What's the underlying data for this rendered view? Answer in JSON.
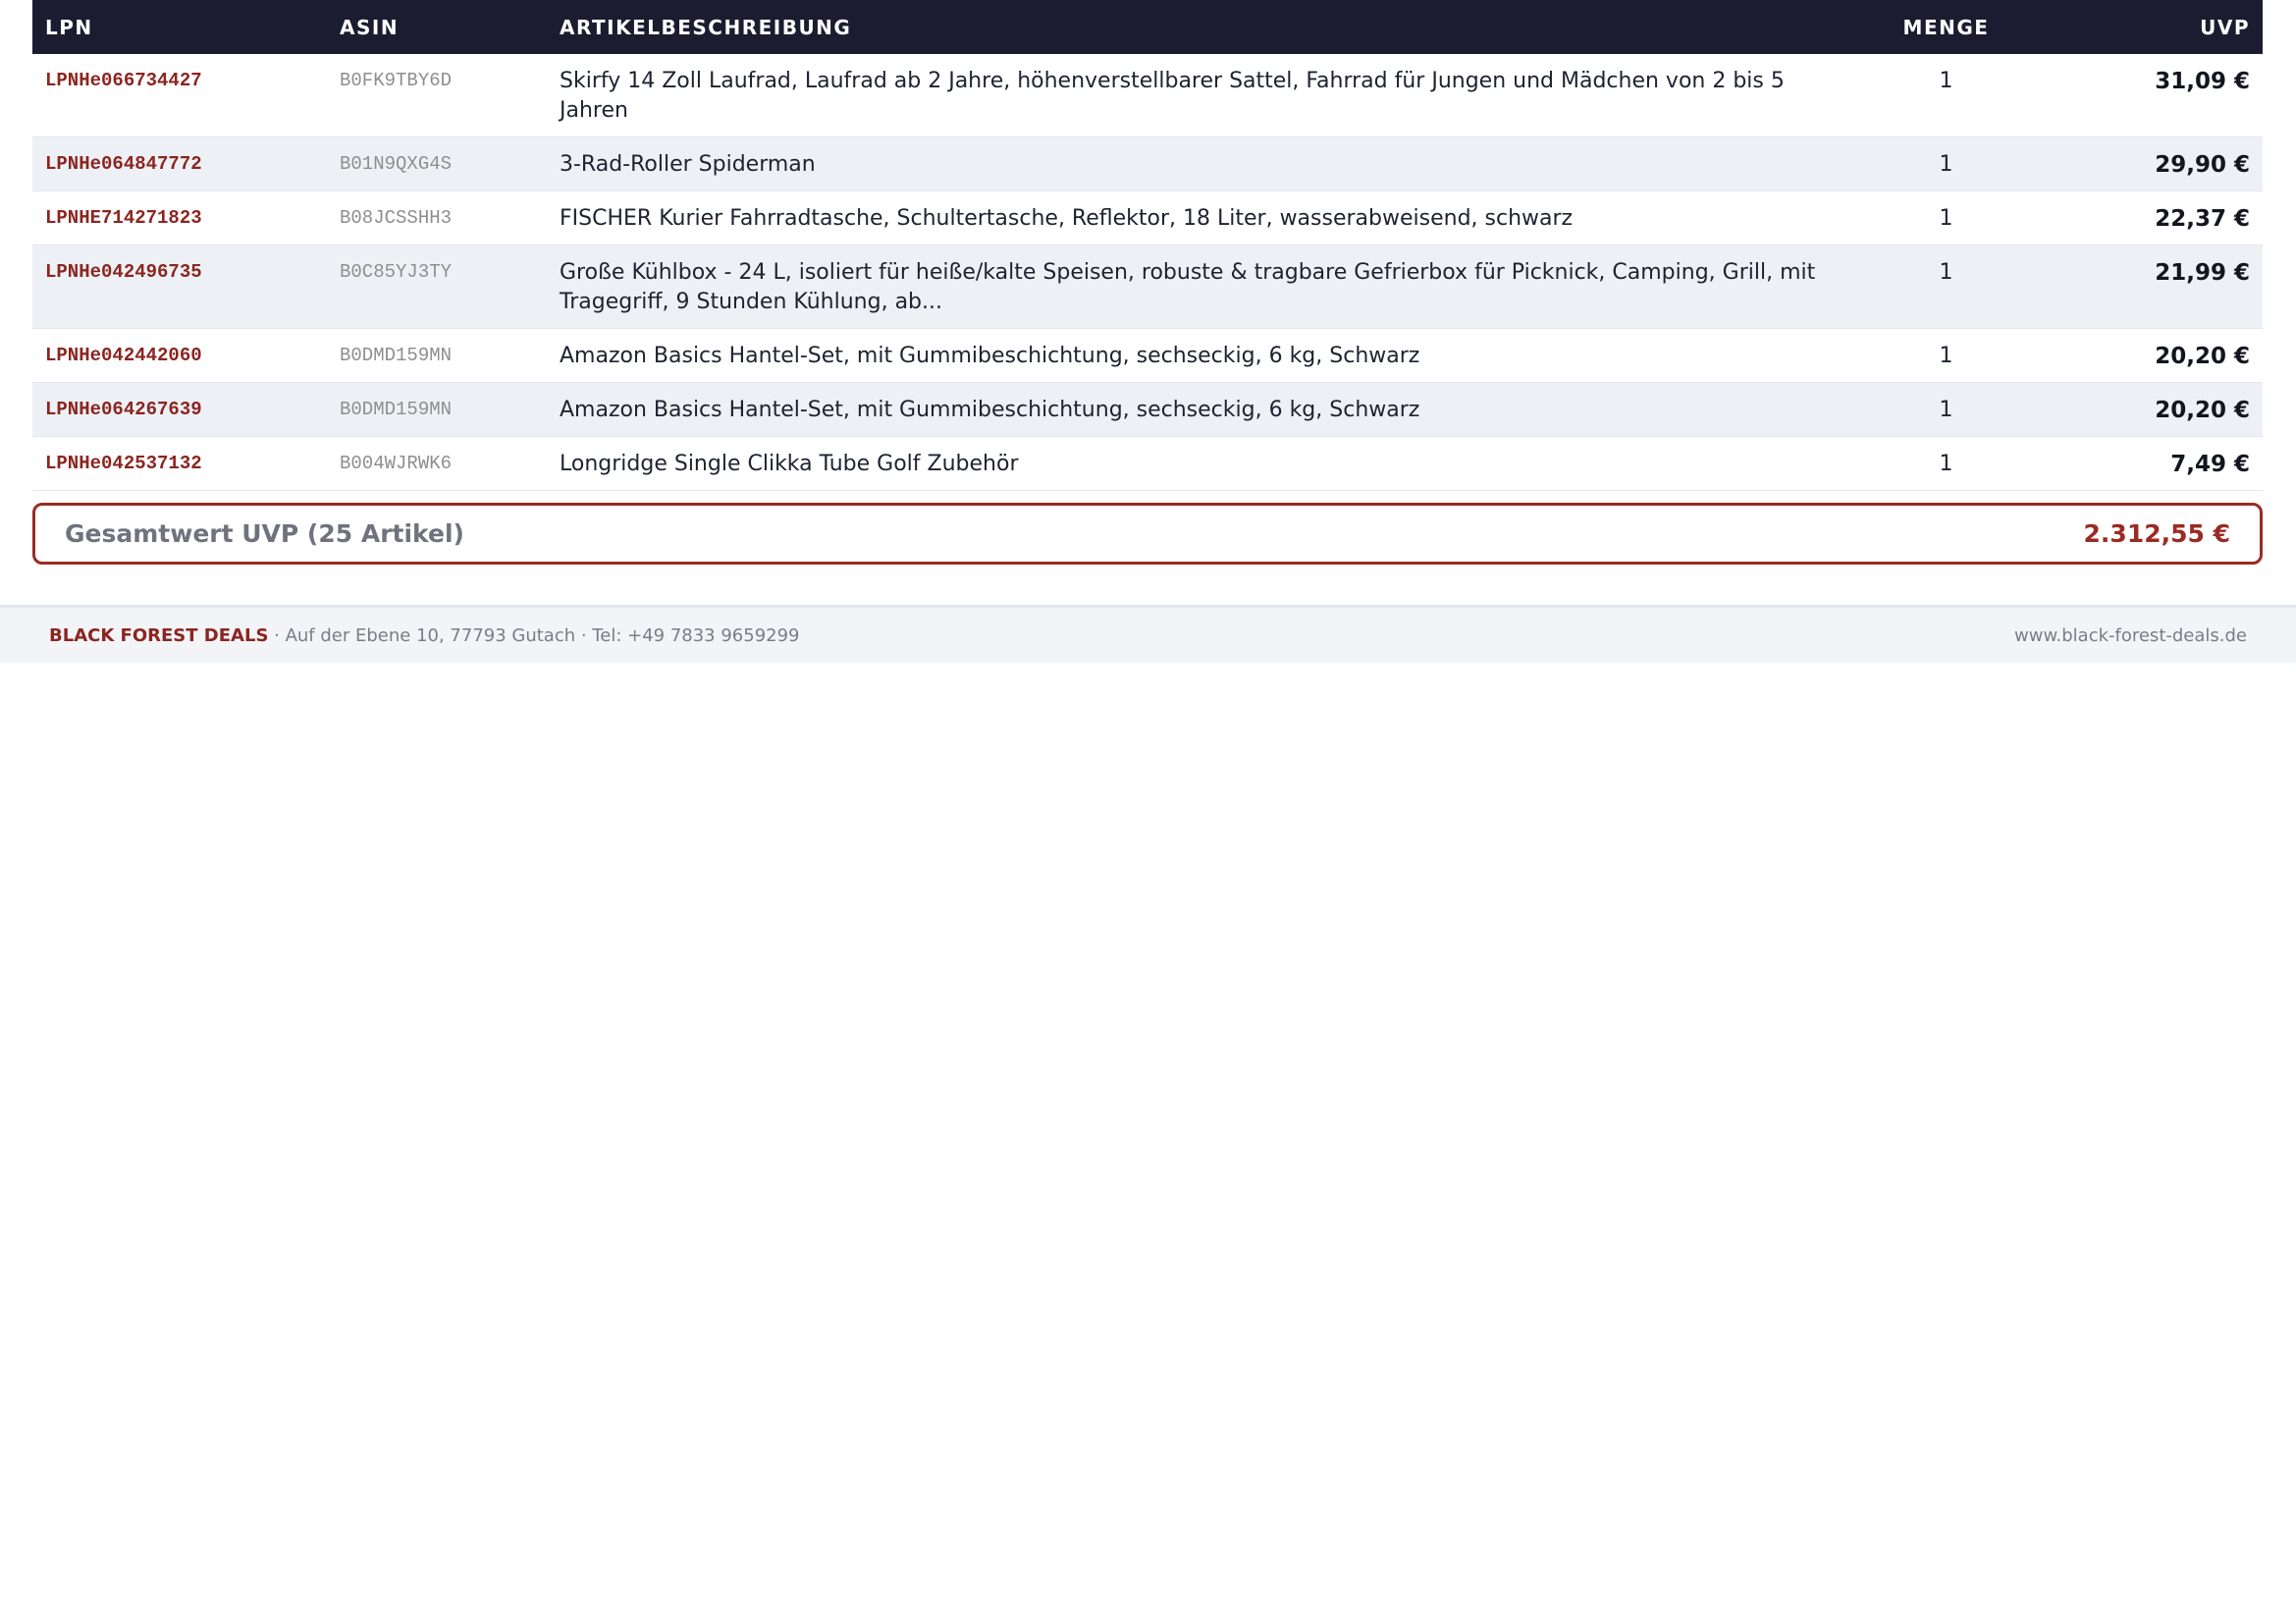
{
  "table": {
    "headers": {
      "lpn": "LPN",
      "asin": "ASIN",
      "description": "ARTIKELBESCHREIBUNG",
      "quantity": "MENGE",
      "uvp": "UVP"
    },
    "rows": [
      {
        "lpn": "LPNHe066734427",
        "asin": "B0FK9TBY6D",
        "description": "Skirfy 14 Zoll Laufrad, Laufrad ab 2 Jahre, höhenverstellbarer Sattel, Fahrrad für Jungen und Mädchen von 2 bis 5 Jahren",
        "quantity": "1",
        "uvp": "31,09 €"
      },
      {
        "lpn": "LPNHe064847772",
        "asin": "B01N9QXG4S",
        "description": "3-Rad-Roller Spiderman",
        "quantity": "1",
        "uvp": "29,90 €"
      },
      {
        "lpn": "LPNHE714271823",
        "asin": "B08JCSSHH3",
        "description": "FISCHER Kurier Fahrradtasche, Schultertasche, Reflektor, 18 Liter, wasserabweisend, schwarz",
        "quantity": "1",
        "uvp": "22,37 €"
      },
      {
        "lpn": "LPNHe042496735",
        "asin": "B0C85YJ3TY",
        "description": "Große Kühlbox - 24 L, isoliert für heiße/kalte Speisen, robuste & tragbare Gefrierbox für Picknick, Camping, Grill, mit Tragegriff, 9 Stunden Kühlung, ab...",
        "quantity": "1",
        "uvp": "21,99 €"
      },
      {
        "lpn": "LPNHe042442060",
        "asin": "B0DMD159MN",
        "description": "Amazon Basics Hantel-Set, mit Gummibeschichtung, sechseckig, 6 kg, Schwarz",
        "quantity": "1",
        "uvp": "20,20 €"
      },
      {
        "lpn": "LPNHe064267639",
        "asin": "B0DMD159MN",
        "description": "Amazon Basics Hantel-Set, mit Gummibeschichtung, sechseckig, 6 kg, Schwarz",
        "quantity": "1",
        "uvp": "20,20 €"
      },
      {
        "lpn": "LPNHe042537132",
        "asin": "B004WJRWK6",
        "description": "Longridge Single Clikka Tube Golf Zubehör",
        "quantity": "1",
        "uvp": "7,49 €"
      }
    ]
  },
  "total": {
    "label": "Gesamtwert UVP (25 Artikel)",
    "value": "2.312,55 €"
  },
  "footer": {
    "brand": "BLACK FOREST DEALS",
    "address": " · Auf der Ebene 10, 77793 Gutach · Tel: +49 7833 9659299",
    "website": "www.black-forest-deals.de"
  },
  "colors": {
    "header_bg": "#1b1c30",
    "accent_red": "#8b2520",
    "row_alt_bg": "#edf1f5",
    "footer_bg": "#f3f4f8"
  }
}
